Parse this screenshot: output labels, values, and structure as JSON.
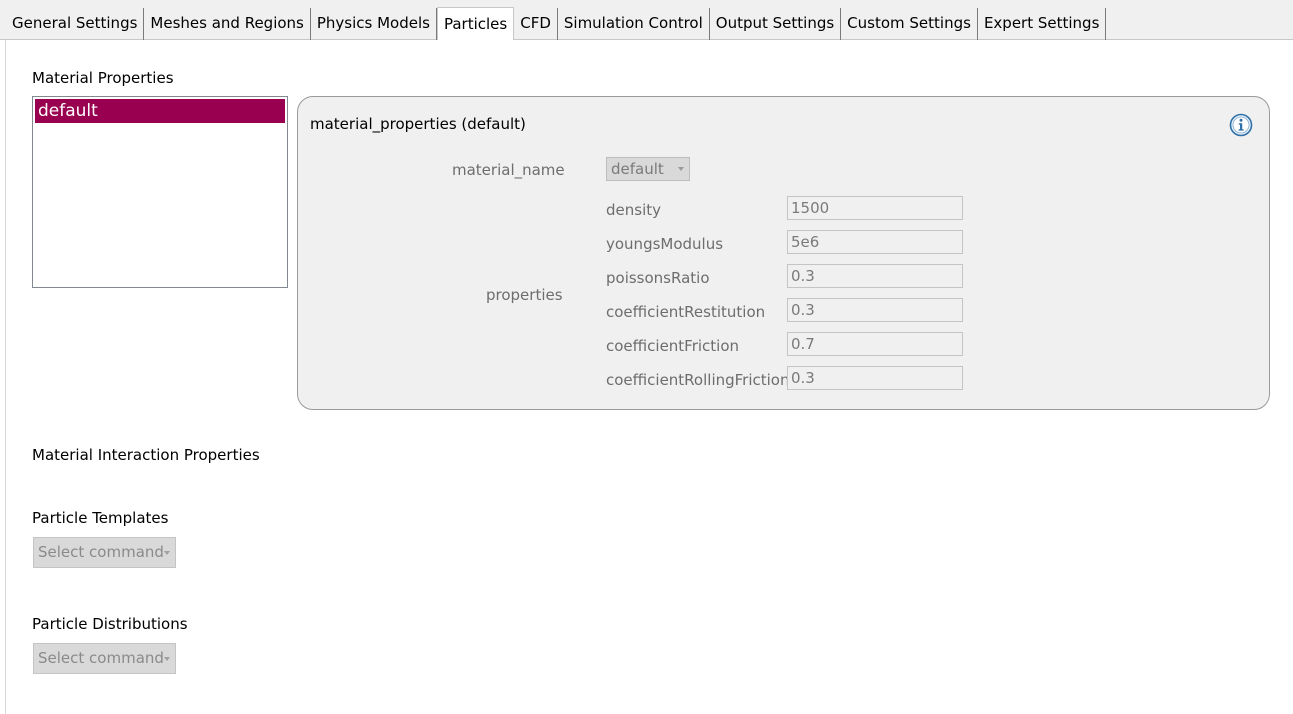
{
  "tabs": [
    {
      "label": "General Settings"
    },
    {
      "label": "Meshes and Regions"
    },
    {
      "label": "Physics Models"
    },
    {
      "label": "Particles",
      "active": true
    },
    {
      "label": "CFD"
    },
    {
      "label": "Simulation Control"
    },
    {
      "label": "Output Settings"
    },
    {
      "label": "Custom Settings"
    },
    {
      "label": "Expert Settings"
    }
  ],
  "material_properties": {
    "section_label": "Material Properties",
    "list_items": [
      "default"
    ],
    "selected_item": "default",
    "panel": {
      "title": "material_properties (default)",
      "info_icon": "info-icon",
      "material_name_label": "material_name",
      "material_name_value": "default",
      "properties_label": "properties",
      "properties": [
        {
          "name": "density",
          "value": "1500"
        },
        {
          "name": "youngsModulus",
          "value": "5e6"
        },
        {
          "name": "poissonsRatio",
          "value": "0.3"
        },
        {
          "name": "coefficientRestitution",
          "value": "0.3"
        },
        {
          "name": "coefficientFriction",
          "value": "0.7"
        },
        {
          "name": "coefficientRollingFriction",
          "value": "0.3"
        }
      ]
    }
  },
  "material_interaction": {
    "section_label": "Material Interaction Properties"
  },
  "particle_templates": {
    "section_label": "Particle Templates",
    "command_placeholder": "Select command"
  },
  "particle_distributions": {
    "section_label": "Particle Distributions",
    "command_placeholder": "Select command"
  },
  "colors": {
    "selection": "#990050",
    "panel_bg": "#f0f0f0",
    "disabled_text": "#7a7a7a",
    "info_icon": "#2f6fa8"
  }
}
